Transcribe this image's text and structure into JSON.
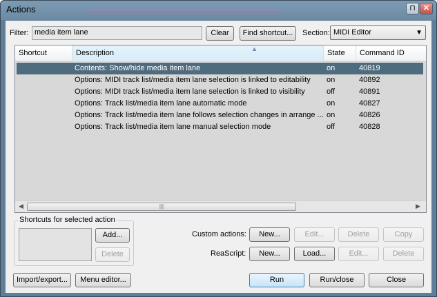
{
  "window": {
    "title": "Actions",
    "pin_glyph": "⊓",
    "close_glyph": "✕"
  },
  "filter": {
    "label": "Filter:",
    "value": "media item lane"
  },
  "buttons": {
    "clear": "Clear",
    "find_shortcut": "Find shortcut...",
    "add": "Add...",
    "delete": "Delete",
    "import_export": "Import/export...",
    "menu_editor": "Menu editor...",
    "run": "Run",
    "run_close": "Run/close",
    "close": "Close"
  },
  "section": {
    "label": "Section:",
    "value": "MIDI Editor"
  },
  "list": {
    "columns": [
      "Shortcut",
      "Description",
      "State",
      "Command ID"
    ],
    "sorted_column": "Description",
    "rows": [
      {
        "shortcut": "",
        "description": "Contents: Show/hide media item lane",
        "state": "on",
        "command_id": "40819",
        "selected": true
      },
      {
        "shortcut": "",
        "description": "Options: MIDI track list/media item lane selection is linked to editability",
        "state": "on",
        "command_id": "40892"
      },
      {
        "shortcut": "",
        "description": "Options: MIDI track list/media item lane selection is linked to visibility",
        "state": "off",
        "command_id": "40891"
      },
      {
        "shortcut": "",
        "description": "Options: Track list/media item lane automatic mode",
        "state": "on",
        "command_id": "40827"
      },
      {
        "shortcut": "",
        "description": "Options: Track list/media item lane follows selection changes in arrange ...",
        "state": "on",
        "command_id": "40826"
      },
      {
        "shortcut": "",
        "description": "Options: Track list/media item lane manual selection mode",
        "state": "off",
        "command_id": "40828"
      }
    ]
  },
  "shortcuts_group": {
    "title": "Shortcuts for selected action"
  },
  "custom_actions": {
    "label": "Custom actions:",
    "new": "New...",
    "edit": "Edit...",
    "delete": "Delete",
    "copy": "Copy"
  },
  "reascript": {
    "label": "ReaScript:",
    "new": "New...",
    "load": "Load...",
    "edit": "Edit...",
    "delete": "Delete"
  }
}
